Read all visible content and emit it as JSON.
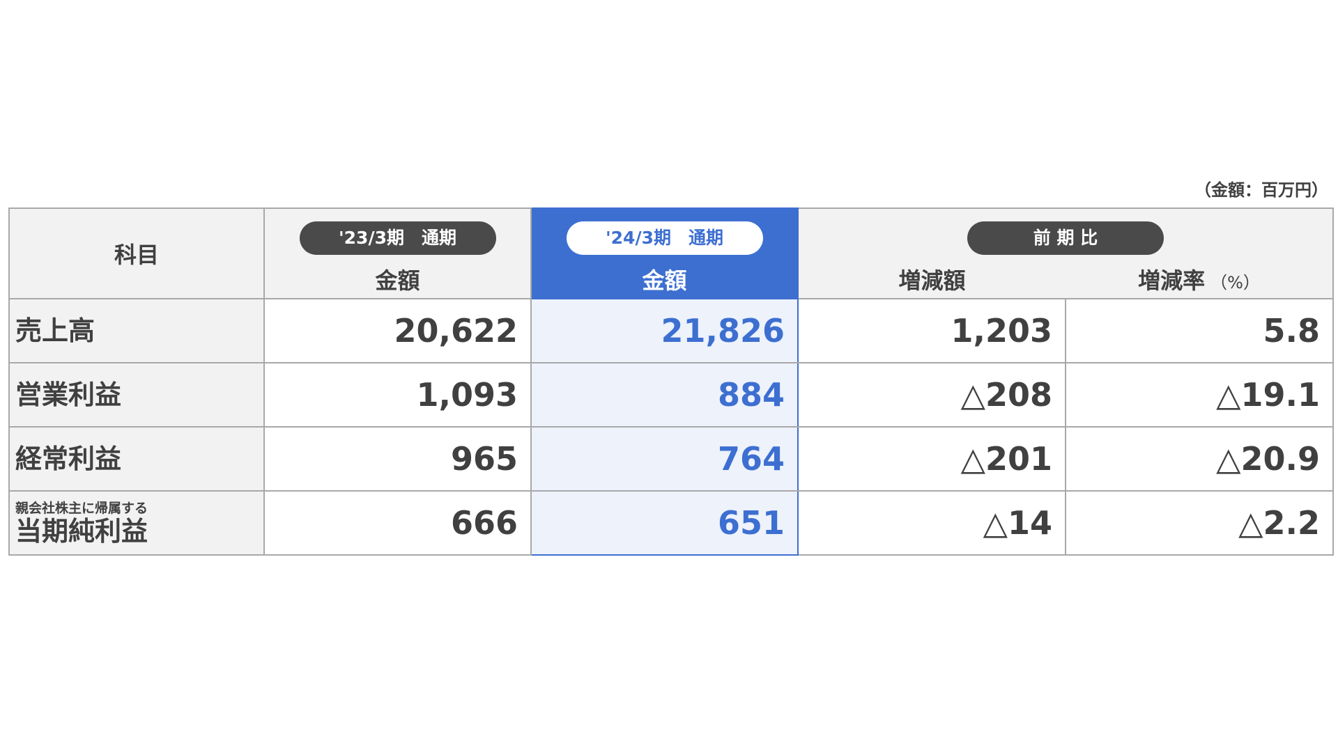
{
  "unit_note": "（金額：百万円）",
  "header": {
    "item_label": "科目",
    "prev_period_label": "'23/3期　通期",
    "prev_amount_label": "金額",
    "curr_period_label": "'24/3期　通期",
    "curr_amount_label": "金額",
    "comparison_label": "前 期 比",
    "change_amount_label": "増減額",
    "change_rate_label": "増減率",
    "change_rate_unit": "（%）"
  },
  "rows": [
    {
      "label_small": "",
      "label": "売上高",
      "prev": "20,622",
      "curr": "21,826",
      "diff": "1,203",
      "rate": "5.8"
    },
    {
      "label_small": "",
      "label": "営業利益",
      "prev": "1,093",
      "curr": "884",
      "diff": "△208",
      "rate": "△19.1"
    },
    {
      "label_small": "",
      "label": "経常利益",
      "prev": "965",
      "curr": "764",
      "diff": "△201",
      "rate": "△20.9"
    },
    {
      "label_small": "親会社株主に帰属する",
      "label": "当期純利益",
      "prev": "666",
      "curr": "651",
      "diff": "△14",
      "rate": "△2.2"
    }
  ],
  "colors": {
    "accent": "#3d6fd1",
    "header_bg": "#f2f2f2",
    "pill_dark": "#4a4a4a",
    "highlight_bg": "#edf2fb"
  }
}
